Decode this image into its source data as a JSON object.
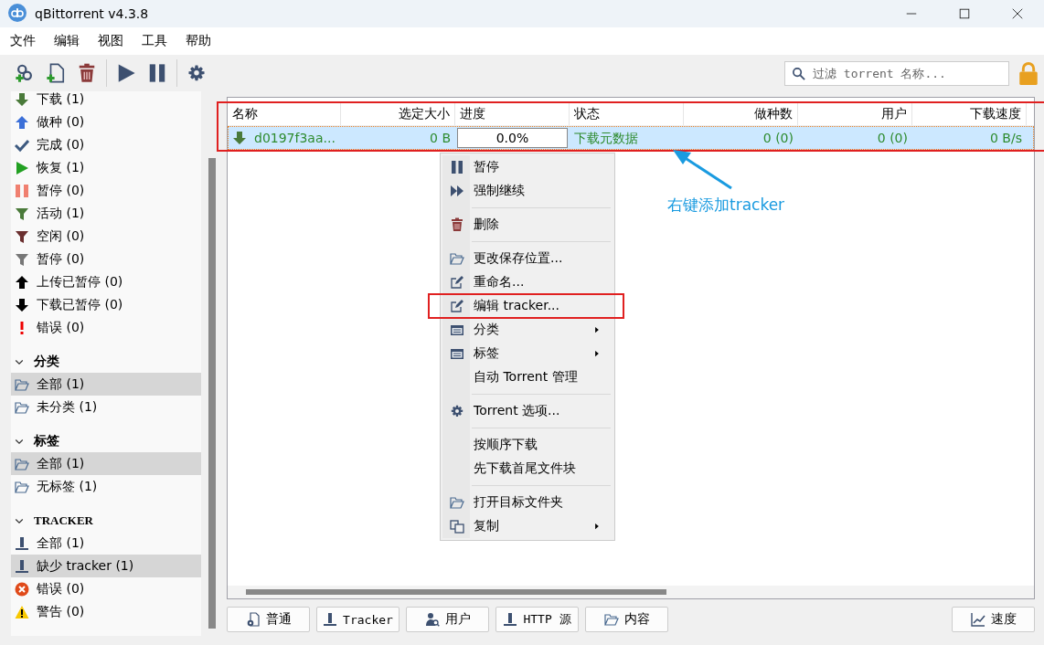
{
  "window": {
    "title": "qBittorrent v4.3.8"
  },
  "menu_bar": [
    "文件",
    "编辑",
    "视图",
    "工具",
    "帮助"
  ],
  "toolbar": [
    {
      "kind": "add-link"
    },
    {
      "kind": "add-file"
    },
    {
      "kind": "delete"
    },
    {
      "kind": "sep"
    },
    {
      "kind": "play"
    },
    {
      "kind": "pause"
    },
    {
      "kind": "sep"
    },
    {
      "kind": "gear"
    }
  ],
  "search": {
    "placeholder": "过滤 torrent 名称..."
  },
  "sidebar": {
    "sections": [
      {
        "items": [
          {
            "label": "下载 (1)",
            "kind": "down-green",
            "selected": false
          },
          {
            "label": "做种 (0)",
            "kind": "up-blue",
            "selected": false
          },
          {
            "label": "完成 (0)",
            "kind": "check",
            "selected": false
          },
          {
            "label": "恢复 (1)",
            "kind": "play",
            "selected": false
          },
          {
            "label": "暂停 (0)",
            "kind": "pause",
            "selected": false
          },
          {
            "label": "活动 (1)",
            "kind": "filter-active",
            "selected": false
          },
          {
            "label": "空闲 (0)",
            "kind": "filter-inactive",
            "selected": false
          },
          {
            "label": "暂停 (0)",
            "kind": "filter-stalled",
            "selected": false
          },
          {
            "label": "上传已暂停 (0)",
            "kind": "up-black",
            "selected": false
          },
          {
            "label": "下载已暂停 (0)",
            "kind": "down-black",
            "selected": false
          },
          {
            "label": "错误 (0)",
            "kind": "exclaim",
            "selected": false
          }
        ]
      },
      {
        "title": "分类",
        "expanded": true,
        "items": [
          {
            "label": "全部 (1)",
            "kind": "folder",
            "selected": true
          },
          {
            "label": "未分类 (1)",
            "kind": "folder",
            "selected": false
          }
        ]
      },
      {
        "title": "标签",
        "expanded": true,
        "items": [
          {
            "label": "全部 (1)",
            "kind": "folder",
            "selected": true
          },
          {
            "label": "无标签 (1)",
            "kind": "folder",
            "selected": false
          }
        ]
      },
      {
        "title": "TRACKER",
        "expanded": true,
        "items": [
          {
            "label": "全部 (1)",
            "kind": "tracker",
            "selected": false
          },
          {
            "label": "缺少 tracker (1)",
            "kind": "tracker",
            "selected": true
          },
          {
            "label": "错误 (0)",
            "kind": "error",
            "selected": false
          },
          {
            "label": "警告 (0)",
            "kind": "warning",
            "selected": false
          }
        ]
      }
    ]
  },
  "table": {
    "columns": [
      "名称",
      "选定大小",
      "进度",
      "状态",
      "做种数",
      "用户",
      "下载速度"
    ],
    "rows": [
      {
        "selected": true,
        "name": "d0197f3aa...",
        "size": "0 B",
        "progress": "0.0%",
        "status": "下载元数据",
        "seeds": "0 (0)",
        "peers": "0 (0)",
        "speed": "0 B/s"
      }
    ]
  },
  "context_menu": [
    {
      "kind": "pause",
      "label": "暂停",
      "submenu": false
    },
    {
      "kind": "force",
      "label": "强制继续",
      "submenu": false
    },
    {
      "kind": "separator"
    },
    {
      "kind": "delete",
      "label": "删除",
      "submenu": false
    },
    {
      "kind": "separator"
    },
    {
      "kind": "folder",
      "label": "更改保存位置...",
      "submenu": false
    },
    {
      "kind": "edit",
      "label": "重命名...",
      "submenu": false
    },
    {
      "kind": "edit",
      "label": "编辑 tracker...",
      "submenu": false
    },
    {
      "kind": "list",
      "label": "分类",
      "submenu": true
    },
    {
      "kind": "list",
      "label": "标签",
      "submenu": true
    },
    {
      "kind": "plain",
      "label": "自动 Torrent 管理",
      "submenu": false
    },
    {
      "kind": "separator"
    },
    {
      "kind": "gear",
      "label": "Torrent 选项...",
      "submenu": false
    },
    {
      "kind": "separator"
    },
    {
      "kind": "plain",
      "label": "按顺序下载",
      "submenu": false
    },
    {
      "kind": "plain",
      "label": "先下载首尾文件块",
      "submenu": false
    },
    {
      "kind": "separator"
    },
    {
      "kind": "folder",
      "label": "打开目标文件夹",
      "submenu": false
    },
    {
      "kind": "copy",
      "label": "复制",
      "submenu": true
    }
  ],
  "bottom_tabs": [
    {
      "kind": "general",
      "label": "普通"
    },
    {
      "kind": "tracker",
      "label": "Tracker"
    },
    {
      "kind": "peers",
      "label": "用户"
    },
    {
      "kind": "tracker",
      "label": "HTTP 源"
    },
    {
      "kind": "folder",
      "label": "内容"
    }
  ],
  "speed_button": {
    "label": "速度"
  },
  "annotation": {
    "note": "右键添加tracker"
  }
}
